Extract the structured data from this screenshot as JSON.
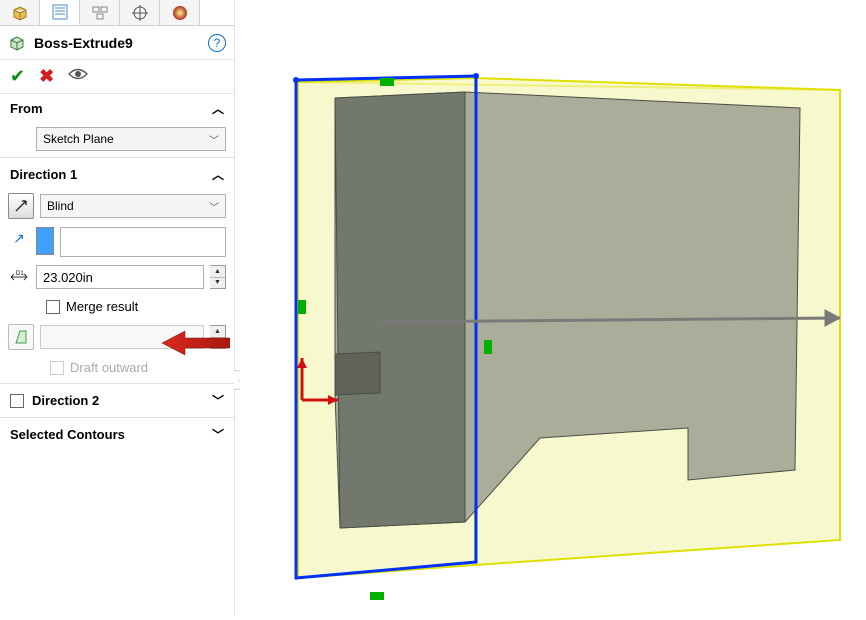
{
  "tabs": [
    "feature-tree",
    "property-manager",
    "configuration-manager",
    "dimxpert",
    "appearance"
  ],
  "feature": {
    "title": "Boss-Extrude9"
  },
  "actions": {
    "ok": "✓",
    "cancel": "✕",
    "preview": "👁"
  },
  "from": {
    "label": "From",
    "selected": "Sketch Plane"
  },
  "direction1": {
    "label": "Direction 1",
    "end_condition": "Blind",
    "distance": "23.020in",
    "merge_result_label": "Merge result",
    "draft_outward_label": "Draft outward"
  },
  "direction2": {
    "label": "Direction 2"
  },
  "selected_contours": {
    "label": "Selected Contours"
  }
}
